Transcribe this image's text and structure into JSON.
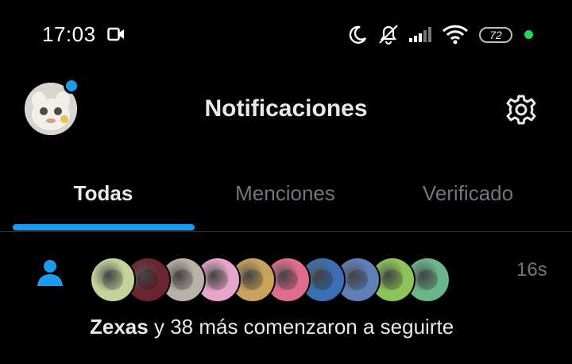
{
  "status_bar": {
    "time": "17:03",
    "battery": "72",
    "icons": [
      "video-camera-icon",
      "moon-icon",
      "bell-off-icon",
      "signal-icon",
      "wifi-icon",
      "battery-icon"
    ]
  },
  "header": {
    "title": "Notificaciones",
    "settings_icon": "gear-icon"
  },
  "tabs": [
    {
      "label": "Todas",
      "active": true
    },
    {
      "label": "Menciones",
      "active": false
    },
    {
      "label": "Verificado",
      "active": false
    }
  ],
  "notification": {
    "icon": "person-icon",
    "username": "Zexas",
    "message": "y 38 más comenzaron a seguirte",
    "time": "16s",
    "follower_avatars": [
      {
        "color": "#c4d39a"
      },
      {
        "color": "#6a2530"
      },
      {
        "color": "#b9b2a8"
      },
      {
        "color": "#e6a5c9"
      },
      {
        "color": "#c9a35c"
      },
      {
        "color": "#e06d8e"
      },
      {
        "color": "#3b6fb3"
      },
      {
        "color": "#5f7fb8"
      },
      {
        "color": "#8cc45a"
      },
      {
        "color": "#6ab58a"
      }
    ]
  },
  "colors": {
    "accent": "#1d9bf0",
    "background": "#000000",
    "muted": "#71767b",
    "status_dot": "#1ed760"
  }
}
